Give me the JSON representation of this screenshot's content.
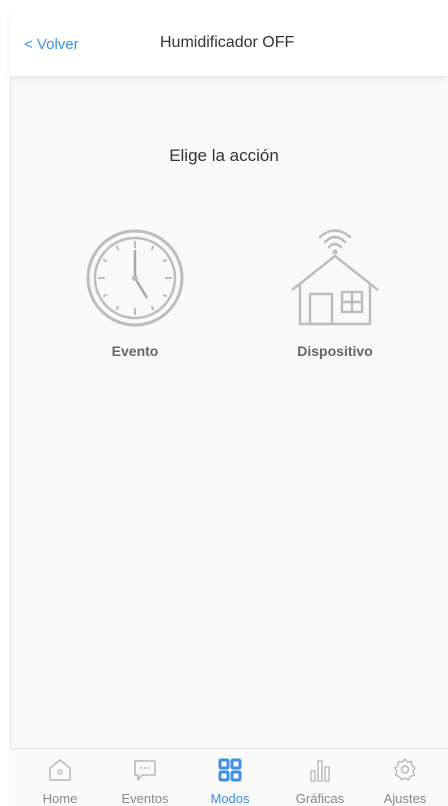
{
  "header": {
    "back_label": "< Volver",
    "title": "Humidificador OFF"
  },
  "main": {
    "prompt": "Elige la acción",
    "options": [
      {
        "label": "Evento",
        "icon": "clock-icon"
      },
      {
        "label": "Dispositivo",
        "icon": "smart-home-icon"
      }
    ]
  },
  "tabbar": {
    "active_color": "#3d8fe8",
    "items": [
      {
        "label": "Home",
        "icon": "home-icon"
      },
      {
        "label": "Eventos",
        "icon": "chat-bubble-icon"
      },
      {
        "label": "Modos",
        "icon": "grid-icon",
        "active": true
      },
      {
        "label": "Gráficas",
        "icon": "bar-chart-icon"
      },
      {
        "label": "Ajustes",
        "icon": "gear-icon"
      }
    ]
  }
}
